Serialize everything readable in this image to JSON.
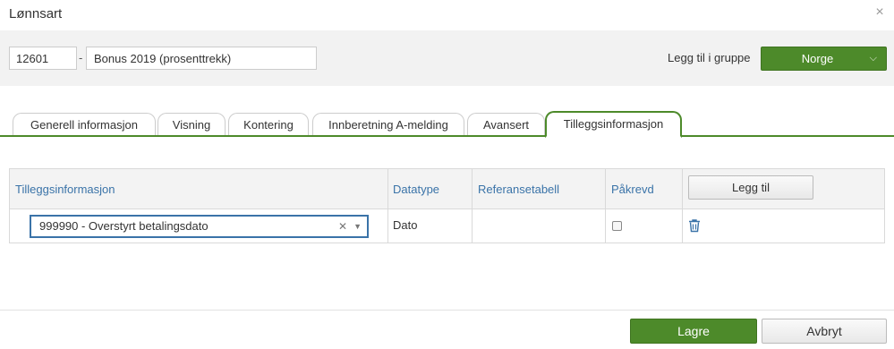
{
  "dialog": {
    "title": "Lønnsart",
    "close_glyph": "×"
  },
  "header": {
    "code_value": "12601",
    "separator": "-",
    "name_value": "Bonus 2019 (prosenttrekk)",
    "group_label": "Legg til i gruppe",
    "group_button": "Norge"
  },
  "tabs": [
    {
      "label": "Generell informasjon"
    },
    {
      "label": "Visning"
    },
    {
      "label": "Kontering"
    },
    {
      "label": "Innberetning A-melding"
    },
    {
      "label": "Avansert"
    },
    {
      "label": "Tilleggsinformasjon",
      "active": true
    }
  ],
  "table": {
    "headers": [
      "Tilleggsinformasjon",
      "Datatype",
      "Referansetabell",
      "Påkrevd"
    ],
    "add_button": "Legg til",
    "rows": [
      {
        "selected": "999990 - Overstyrt betalingsdato",
        "datatype": "Dato",
        "referansetabell": "",
        "required": false
      }
    ]
  },
  "footer": {
    "save_label": "Lagre",
    "cancel_label": "Avbryt"
  },
  "colors": {
    "accent": "#4d8a2a",
    "link": "#3a73a8"
  },
  "icons": {
    "close": "close-icon",
    "chevron": "chevron-down-icon",
    "trash": "trash-icon"
  }
}
